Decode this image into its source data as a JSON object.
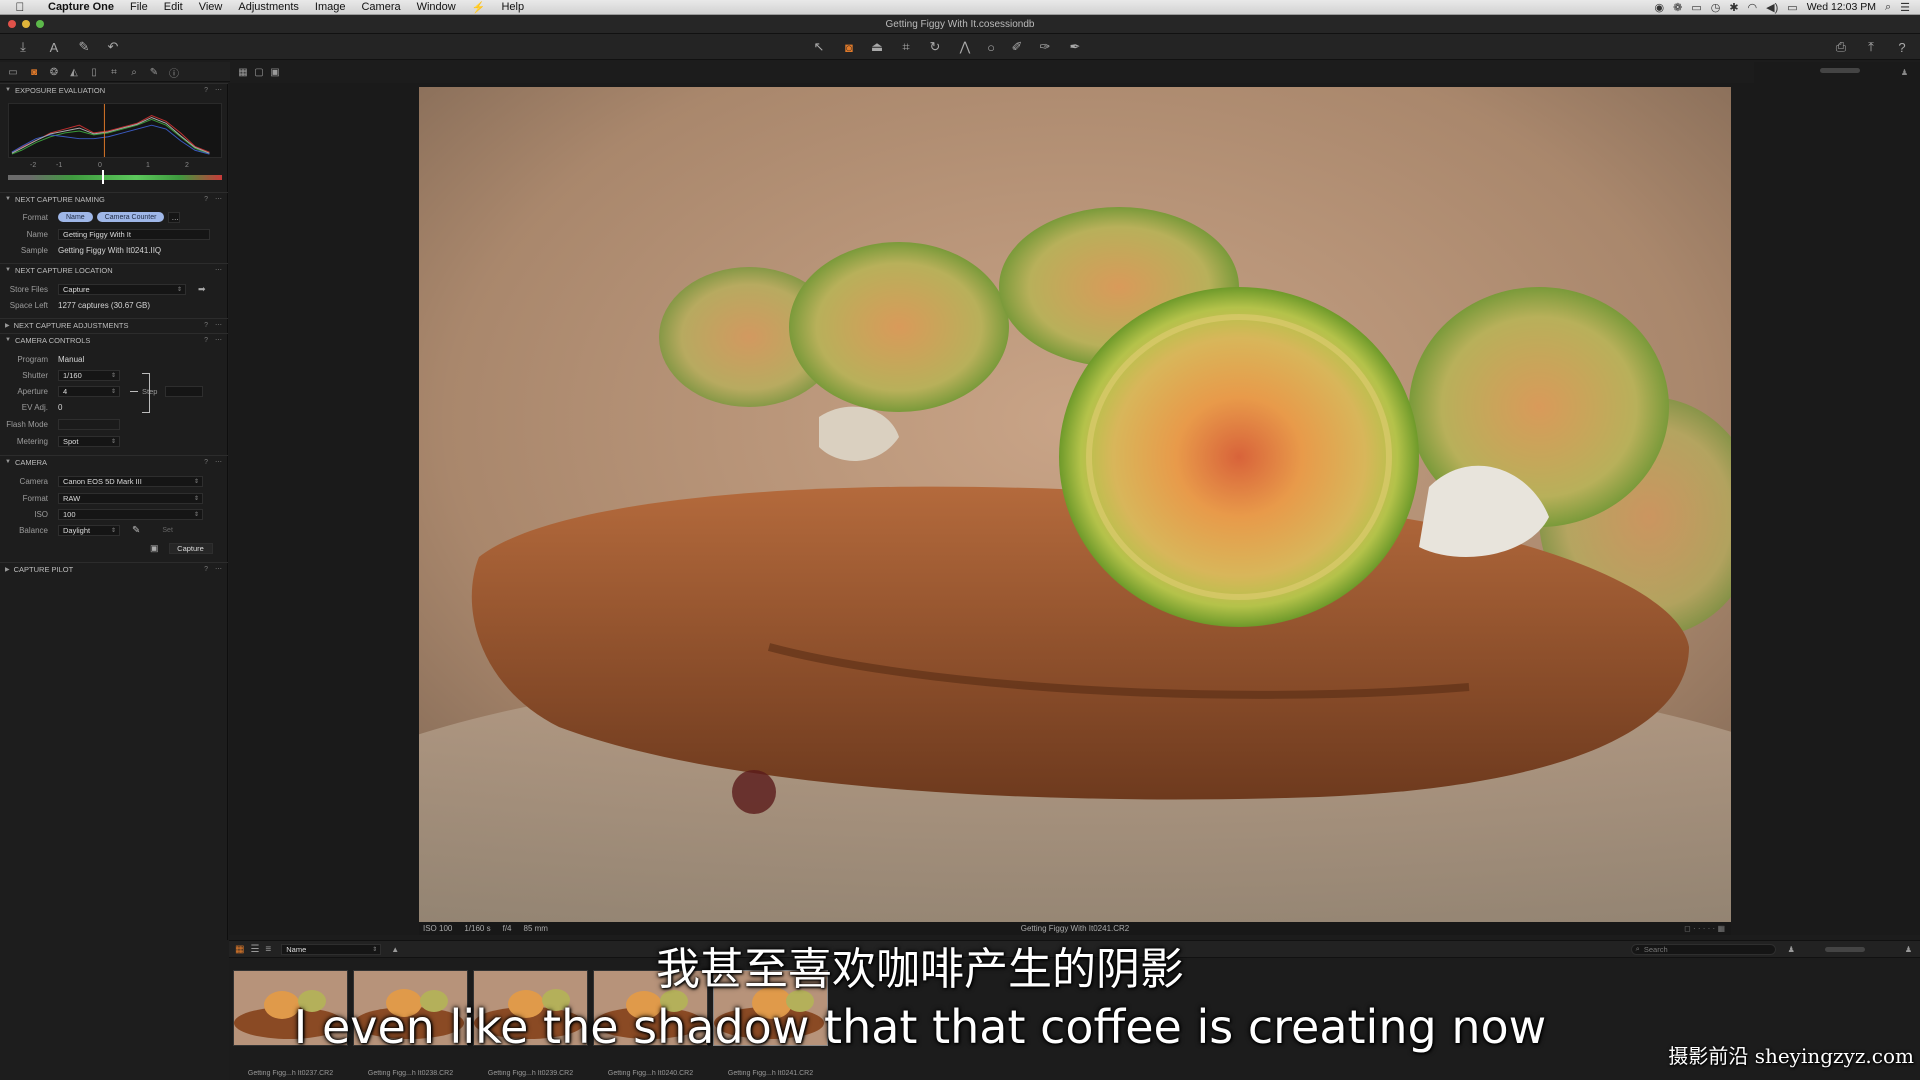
{
  "menubar": {
    "app": "Capture One",
    "items": [
      "File",
      "Edit",
      "View",
      "Adjustments",
      "Image",
      "Camera",
      "Window",
      "⚡",
      "Help"
    ],
    "clock": "Wed 12:03 PM"
  },
  "window": {
    "title": "Getting Figgy With It.cosessiondb"
  },
  "sidebar": {
    "exposure": {
      "title": "EXPOSURE EVALUATION",
      "scale": [
        "-2",
        "-1",
        "0",
        "1",
        "2"
      ]
    },
    "naming": {
      "title": "NEXT CAPTURE NAMING",
      "format_label": "Format",
      "format_tokens": [
        "Name",
        "Camera Counter"
      ],
      "name_label": "Name",
      "name_value": "Getting Figgy With It",
      "sample_label": "Sample",
      "sample_value": "Getting Figgy With It0241.IIQ"
    },
    "location": {
      "title": "NEXT CAPTURE LOCATION",
      "store_label": "Store Files",
      "store_value": "Capture",
      "space_label": "Space Left",
      "space_value": "1277 captures (30.67 GB)"
    },
    "adjustments": {
      "title": "NEXT CAPTURE ADJUSTMENTS"
    },
    "controls": {
      "title": "CAMERA CONTROLS",
      "program_label": "Program",
      "program_value": "Manual",
      "shutter_label": "Shutter",
      "shutter_value": "1/160",
      "aperture_label": "Aperture",
      "aperture_value": "4",
      "ev_label": "EV Adj.",
      "ev_value": "0",
      "flash_label": "Flash Mode",
      "metering_label": "Metering",
      "metering_value": "Spot",
      "step_label": "Step"
    },
    "camera": {
      "title": "CAMERA",
      "camera_label": "Camera",
      "camera_value": "Canon EOS 5D Mark III",
      "format_label": "Format",
      "format_value": "RAW",
      "iso_label": "ISO",
      "iso_value": "100",
      "balance_label": "Balance",
      "balance_value": "Daylight",
      "set_label": "Set",
      "capture_label": "Capture"
    },
    "pilot": {
      "title": "CAPTURE PILOT"
    }
  },
  "viewer": {
    "iso": "ISO 100",
    "shutter": "1/160 s",
    "aperture": "f/4",
    "focal": "85 mm",
    "filename": "Getting Figgy With It0241.CR2"
  },
  "browser": {
    "sort_value": "Name",
    "search_placeholder": "Search",
    "thumbs": [
      "Getting Figg...h It0237.CR2",
      "Getting Figg...h It0238.CR2",
      "Getting Figg...h It0239.CR2",
      "Getting Figg...h It0240.CR2",
      "Getting Figg...h It0241.CR2"
    ]
  },
  "subtitles": {
    "chinese": "我甚至喜欢咖啡产生的阴影",
    "english": "I even like the shadow that that coffee is creating now"
  },
  "watermark": "摄影前沿 sheyingzyz.com"
}
